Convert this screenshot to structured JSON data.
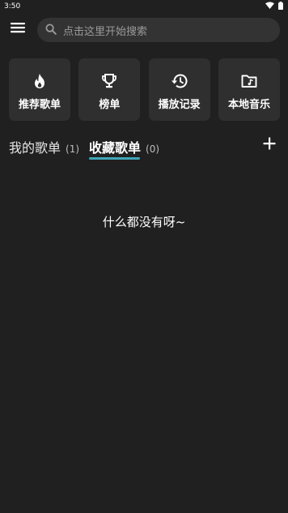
{
  "status_bar": {
    "time": "3:50",
    "icons": [
      "wifi-icon",
      "battery-icon"
    ]
  },
  "top_bar": {
    "menu_icon": "menu-icon",
    "search": {
      "icon": "search-icon",
      "placeholder": "点击这里开始搜索"
    }
  },
  "quick_access": [
    {
      "label": "推荐歌单",
      "icon": "flame-icon"
    },
    {
      "label": "榜单",
      "icon": "trophy-icon"
    },
    {
      "label": "播放记录",
      "icon": "history-icon"
    },
    {
      "label": "本地音乐",
      "icon": "folder-music-icon"
    }
  ],
  "tabs": [
    {
      "label": "我的歌单",
      "count": "(1)",
      "selected": false
    },
    {
      "label": "收藏歌单",
      "count": "(0)",
      "selected": true
    }
  ],
  "add_icon": "plus-icon",
  "accent_color": "#3fa6b8",
  "empty_message": "什么都没有呀~"
}
